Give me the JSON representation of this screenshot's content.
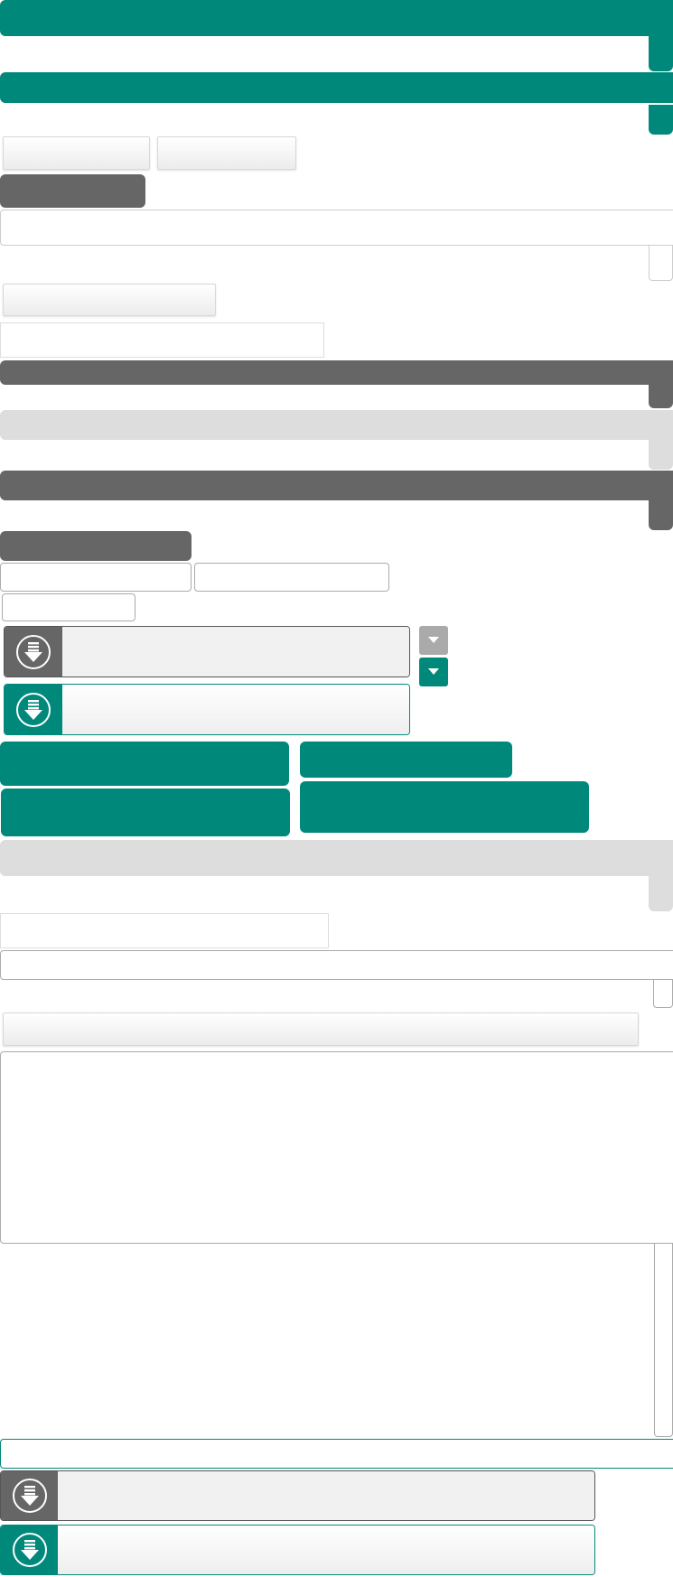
{
  "page": {
    "colors": {
      "teal": "#00897b",
      "dark": "#666666",
      "light": "#dddddd",
      "caret_disabled": "#aaaaaa"
    }
  },
  "header_bars": [
    {
      "name": "top-bar",
      "color": "teal",
      "label": ""
    },
    {
      "name": "second-bar",
      "color": "teal",
      "label": ""
    }
  ],
  "toolbar": {
    "button_1": "",
    "button_2": "",
    "badge": ""
  },
  "fields": {
    "field_1": "",
    "field_2": "",
    "wide_button": "",
    "field_3": ""
  },
  "section_bars": [
    {
      "name": "dark-bar-1",
      "label": ""
    },
    {
      "name": "light-bar-1",
      "label": ""
    },
    {
      "name": "dark-bar-2",
      "label": ""
    }
  ],
  "dark_tab": "",
  "small_inputs": [
    "",
    "",
    ""
  ],
  "downloads": [
    {
      "name": "download-dark",
      "label": "",
      "icon": "download-circle-icon"
    },
    {
      "name": "download-teal",
      "label": "",
      "icon": "download-circle-icon"
    }
  ],
  "carets": [
    {
      "name": "caret-disabled",
      "icon": "chevron-down-icon"
    },
    {
      "name": "caret-active",
      "icon": "chevron-down-icon"
    }
  ],
  "teal_buttons": [
    "",
    "",
    "",
    ""
  ],
  "lower": {
    "light_bar": "",
    "field_a": "",
    "field_b": "",
    "wide_button": "",
    "textarea_1": "",
    "textarea_2": "",
    "teal_field": ""
  },
  "bottom_downloads": [
    {
      "name": "download-dark-bottom",
      "label": "",
      "icon": "download-circle-icon"
    },
    {
      "name": "download-teal-bottom",
      "label": "",
      "icon": "download-circle-icon"
    }
  ]
}
